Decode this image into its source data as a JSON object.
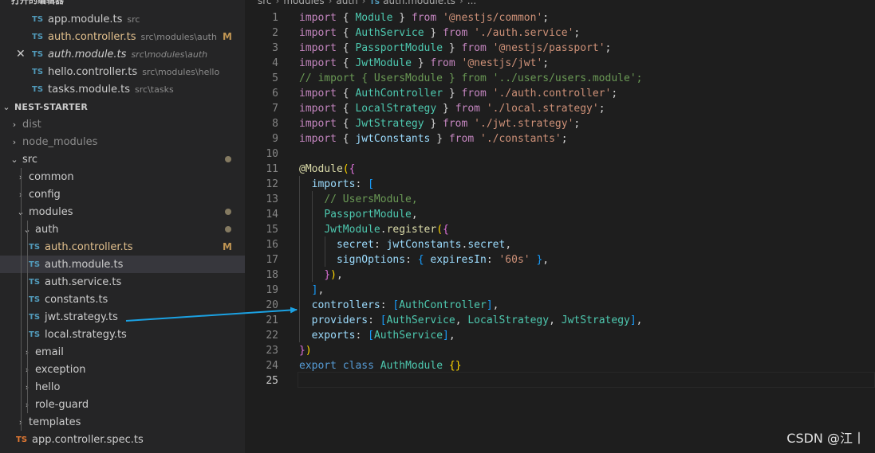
{
  "open_editors": {
    "header": "打开的编辑器",
    "items": [
      {
        "icon": "TS",
        "name": "app.module.ts",
        "path": "src"
      },
      {
        "icon": "TS",
        "name": "auth.controller.ts",
        "path": "src\\modules\\auth",
        "status": "M"
      },
      {
        "icon": "TS",
        "name": "auth.module.ts",
        "path": "src\\modules\\auth",
        "close": "✕"
      },
      {
        "icon": "TS",
        "name": "hello.controller.ts",
        "path": "src\\modules\\hello"
      },
      {
        "icon": "TS",
        "name": "tasks.module.ts",
        "path": "src\\tasks"
      }
    ]
  },
  "explorer": {
    "header": "NEST-STARTER",
    "items": [
      {
        "label": "dist",
        "chev": "›"
      },
      {
        "label": "node_modules",
        "chev": "›"
      },
      {
        "label": "src",
        "chev": "⌄"
      },
      {
        "label": "common",
        "chev": "›"
      },
      {
        "label": "config",
        "chev": "›"
      },
      {
        "label": "modules",
        "chev": "⌄"
      },
      {
        "label": "auth",
        "chev": "⌄"
      },
      {
        "label": "auth.controller.ts",
        "icon": "TS",
        "status": "M"
      },
      {
        "label": "auth.module.ts",
        "icon": "TS"
      },
      {
        "label": "auth.service.ts",
        "icon": "TS"
      },
      {
        "label": "constants.ts",
        "icon": "TS"
      },
      {
        "label": "jwt.strategy.ts",
        "icon": "TS"
      },
      {
        "label": "local.strategy.ts",
        "icon": "TS"
      },
      {
        "label": "email",
        "chev": "›"
      },
      {
        "label": "exception",
        "chev": "›"
      },
      {
        "label": "hello",
        "chev": "›"
      },
      {
        "label": "role-guard",
        "chev": "›"
      },
      {
        "label": "templates",
        "chev": "›"
      },
      {
        "label": "app.controller.spec.ts",
        "icon": "TS"
      }
    ]
  },
  "breadcrumb": [
    "src",
    "modules",
    "auth",
    "auth.module.ts",
    "..."
  ],
  "breadcrumb_icon": "TS",
  "code_lines": [
    [
      [
        "kw",
        "import"
      ],
      [
        "pl",
        " { "
      ],
      [
        "ty",
        "Module"
      ],
      [
        "pl",
        " } "
      ],
      [
        "kw",
        "from"
      ],
      [
        "pl",
        " "
      ],
      [
        "str",
        "'@nestjs/common'"
      ],
      [
        "pl",
        ";"
      ]
    ],
    [
      [
        "kw",
        "import"
      ],
      [
        "pl",
        " { "
      ],
      [
        "ty",
        "AuthService"
      ],
      [
        "pl",
        " } "
      ],
      [
        "kw",
        "from"
      ],
      [
        "pl",
        " "
      ],
      [
        "str",
        "'./auth.service'"
      ],
      [
        "pl",
        ";"
      ]
    ],
    [
      [
        "kw",
        "import"
      ],
      [
        "pl",
        " { "
      ],
      [
        "ty",
        "PassportModule"
      ],
      [
        "pl",
        " } "
      ],
      [
        "kw",
        "from"
      ],
      [
        "pl",
        " "
      ],
      [
        "str",
        "'@nestjs/passport'"
      ],
      [
        "pl",
        ";"
      ]
    ],
    [
      [
        "kw",
        "import"
      ],
      [
        "pl",
        " { "
      ],
      [
        "ty",
        "JwtModule"
      ],
      [
        "pl",
        " } "
      ],
      [
        "kw",
        "from"
      ],
      [
        "pl",
        " "
      ],
      [
        "str",
        "'@nestjs/jwt'"
      ],
      [
        "pl",
        ";"
      ]
    ],
    [
      [
        "cm",
        "// import { UsersModule } from '../users/users.module';"
      ]
    ],
    [
      [
        "kw",
        "import"
      ],
      [
        "pl",
        " { "
      ],
      [
        "ty",
        "AuthController"
      ],
      [
        "pl",
        " } "
      ],
      [
        "kw",
        "from"
      ],
      [
        "pl",
        " "
      ],
      [
        "str",
        "'./auth.controller'"
      ],
      [
        "pl",
        ";"
      ]
    ],
    [
      [
        "kw",
        "import"
      ],
      [
        "pl",
        " { "
      ],
      [
        "ty",
        "LocalStrategy"
      ],
      [
        "pl",
        " } "
      ],
      [
        "kw",
        "from"
      ],
      [
        "pl",
        " "
      ],
      [
        "str",
        "'./local.strategy'"
      ],
      [
        "pl",
        ";"
      ]
    ],
    [
      [
        "kw",
        "import"
      ],
      [
        "pl",
        " { "
      ],
      [
        "ty",
        "JwtStrategy"
      ],
      [
        "pl",
        " } "
      ],
      [
        "kw",
        "from"
      ],
      [
        "pl",
        " "
      ],
      [
        "str",
        "'./jwt.strategy'"
      ],
      [
        "pl",
        ";"
      ]
    ],
    [
      [
        "kw",
        "import"
      ],
      [
        "pl",
        " { "
      ],
      [
        "pr",
        "jwtConstants"
      ],
      [
        "pl",
        " } "
      ],
      [
        "kw",
        "from"
      ],
      [
        "pl",
        " "
      ],
      [
        "str",
        "'./constants'"
      ],
      [
        "pl",
        ";"
      ]
    ],
    [],
    [
      [
        "fn",
        "@Module"
      ],
      [
        "br1",
        "("
      ],
      [
        "br2",
        "{"
      ]
    ],
    [
      [
        "pl",
        "  "
      ],
      [
        "pr",
        "imports"
      ],
      [
        "pl",
        ": "
      ],
      [
        "br3",
        "["
      ]
    ],
    [
      [
        "pl",
        "    "
      ],
      [
        "cm",
        "// UsersModule,"
      ]
    ],
    [
      [
        "pl",
        "    "
      ],
      [
        "ty",
        "PassportModule"
      ],
      [
        "pl",
        ","
      ]
    ],
    [
      [
        "pl",
        "    "
      ],
      [
        "ty",
        "JwtModule"
      ],
      [
        "pl",
        "."
      ],
      [
        "fn",
        "register"
      ],
      [
        "br1",
        "("
      ],
      [
        "br2",
        "{"
      ]
    ],
    [
      [
        "pl",
        "      "
      ],
      [
        "pr",
        "secret"
      ],
      [
        "pl",
        ": "
      ],
      [
        "pr",
        "jwtConstants"
      ],
      [
        "pl",
        "."
      ],
      [
        "pr",
        "secret"
      ],
      [
        "pl",
        ","
      ]
    ],
    [
      [
        "pl",
        "      "
      ],
      [
        "pr",
        "signOptions"
      ],
      [
        "pl",
        ": "
      ],
      [
        "br3",
        "{"
      ],
      [
        "pl",
        " "
      ],
      [
        "pr",
        "expiresIn"
      ],
      [
        "pl",
        ": "
      ],
      [
        "str",
        "'60s'"
      ],
      [
        "pl",
        " "
      ],
      [
        "br3",
        "}"
      ],
      [
        "pl",
        ","
      ]
    ],
    [
      [
        "pl",
        "    "
      ],
      [
        "br2",
        "}"
      ],
      [
        "br1",
        ")"
      ],
      [
        "pl",
        ","
      ]
    ],
    [
      [
        "pl",
        "  "
      ],
      [
        "br3",
        "]"
      ],
      [
        "pl",
        ","
      ]
    ],
    [
      [
        "pl",
        "  "
      ],
      [
        "pr",
        "controllers"
      ],
      [
        "pl",
        ": "
      ],
      [
        "br3",
        "["
      ],
      [
        "ty",
        "AuthController"
      ],
      [
        "br3",
        "]"
      ],
      [
        "pl",
        ","
      ]
    ],
    [
      [
        "pl",
        "  "
      ],
      [
        "pr",
        "providers"
      ],
      [
        "pl",
        ": "
      ],
      [
        "br3",
        "["
      ],
      [
        "ty",
        "AuthService"
      ],
      [
        "pl",
        ", "
      ],
      [
        "ty",
        "LocalStrategy"
      ],
      [
        "pl",
        ", "
      ],
      [
        "ty",
        "JwtStrategy"
      ],
      [
        "br3",
        "]"
      ],
      [
        "pl",
        ","
      ]
    ],
    [
      [
        "pl",
        "  "
      ],
      [
        "pr",
        "exports"
      ],
      [
        "pl",
        ": "
      ],
      [
        "br3",
        "["
      ],
      [
        "ty",
        "AuthService"
      ],
      [
        "br3",
        "]"
      ],
      [
        "pl",
        ","
      ]
    ],
    [
      [
        "br2",
        "}"
      ],
      [
        "br1",
        ")"
      ]
    ],
    [
      [
        "kw2",
        "export"
      ],
      [
        "pl",
        " "
      ],
      [
        "kw2",
        "class"
      ],
      [
        "pl",
        " "
      ],
      [
        "ty",
        "AuthModule"
      ],
      [
        "pl",
        " "
      ],
      [
        "br1",
        "{}"
      ]
    ],
    []
  ],
  "watermark": "CSDN @江丨",
  "colors": {
    "sidebar_bg": "#252526",
    "editor_bg": "#1e1e1e",
    "selected_row": "#37373d",
    "modified": "#e2c08d",
    "arrow": "#1ba1e2"
  }
}
